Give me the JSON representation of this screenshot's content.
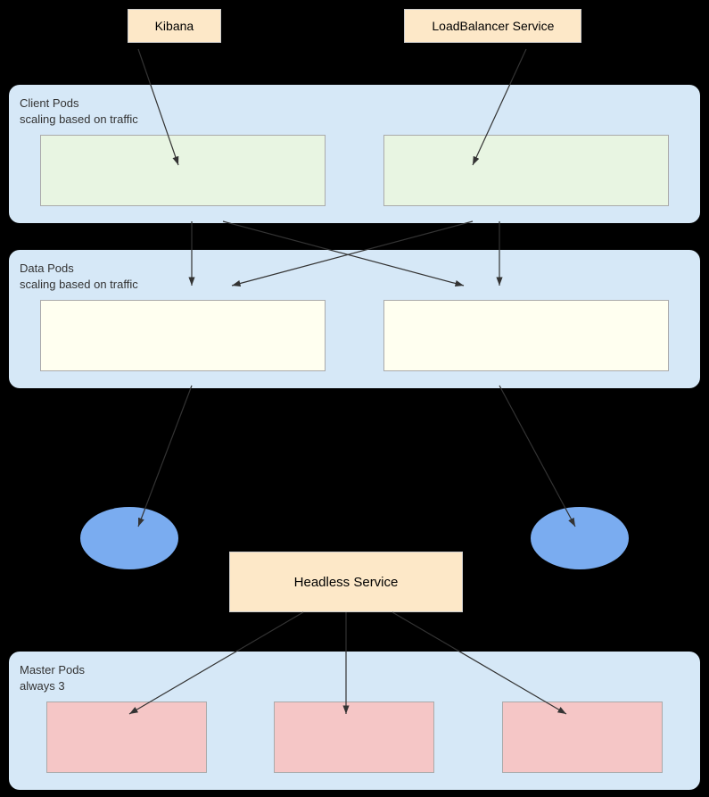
{
  "top": {
    "kibana_label": "Kibana",
    "loadbalancer_label": "LoadBalancer Service"
  },
  "client_pods": {
    "section_label": "Client Pods\nscaling based on traffic"
  },
  "data_pods": {
    "section_label": "Data Pods\nscaling based on traffic"
  },
  "headless_service": {
    "label": "Headless Service"
  },
  "master_pods": {
    "section_label": "Master Pods\nalways 3"
  },
  "colors": {
    "background": "#000000",
    "section_bg": "#d6e8f7",
    "green_pod": "#e8f5e2",
    "yellow_pod": "#fffff0",
    "pink_pod": "#f5c6c6",
    "orange_box": "#fde8c8",
    "oval": "#7aacf0"
  }
}
